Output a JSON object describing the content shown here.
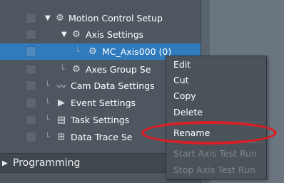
{
  "tree": {
    "items": [
      {
        "label": "Motion Control Setup",
        "arrow": "▼",
        "icon": "⚙"
      },
      {
        "label": "Axis Settings",
        "arrow": "▼",
        "icon": "⚙"
      },
      {
        "label": "MC_Axis000 (0)",
        "icon": "⚙"
      },
      {
        "label": "Axes Group Se",
        "icon": "⚙"
      },
      {
        "label": "Cam Data Settings",
        "icon": "〰"
      },
      {
        "label": "Event Settings",
        "icon": "▶"
      },
      {
        "label": "Task Settings",
        "icon": "▤"
      },
      {
        "label": "Data Trace Se",
        "icon": "⊞"
      }
    ],
    "programming": "Programming"
  },
  "context_menu": {
    "items": [
      {
        "label": "Edit"
      },
      {
        "label": "Cut"
      },
      {
        "label": "Copy"
      },
      {
        "label": "Delete"
      },
      {
        "label": "Rename"
      },
      {
        "label": "Start Axis Test Run"
      },
      {
        "label": "Stop Axis Test Run"
      }
    ]
  },
  "colors": {
    "highlight_ring": "#d81f26",
    "selection": "#2f7bbd"
  }
}
